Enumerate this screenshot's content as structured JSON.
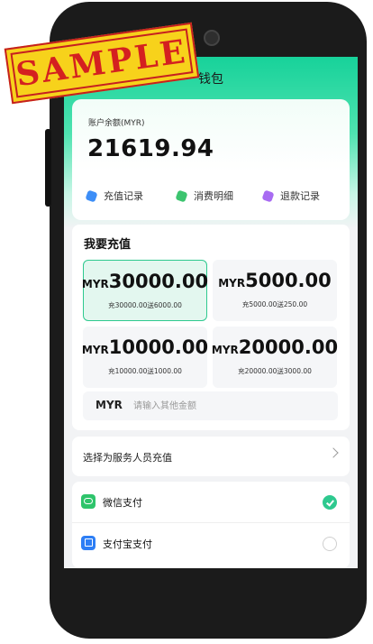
{
  "page": {
    "title": "钱包"
  },
  "balance": {
    "label": "账户余额(MYR)",
    "value": "21619.94"
  },
  "quick_links": [
    {
      "label": "充值记录",
      "icon": "recharge-record-icon",
      "color": "#3d8ef7"
    },
    {
      "label": "消费明细",
      "icon": "consumption-detail-icon",
      "color": "#3cc46f"
    },
    {
      "label": "退款记录",
      "icon": "refund-record-icon",
      "color": "#a86bf2"
    }
  ],
  "recharge": {
    "title": "我要充值",
    "options": [
      {
        "currency": "MYR",
        "amount": "30000.00",
        "bonus": "充30000.00送6000.00",
        "selected": true
      },
      {
        "currency": "MYR",
        "amount": "5000.00",
        "bonus": "充5000.00送250.00",
        "selected": false
      },
      {
        "currency": "MYR",
        "amount": "10000.00",
        "bonus": "充10000.00送1000.00",
        "selected": false
      },
      {
        "currency": "MYR",
        "amount": "20000.00",
        "bonus": "充20000.00送3000.00",
        "selected": false
      }
    ],
    "custom": {
      "currency": "MYR",
      "placeholder": "请输入其他金额",
      "value": ""
    }
  },
  "staff_recharge": {
    "label": "选择为服务人员充值"
  },
  "payment_methods": [
    {
      "label": "微信支付",
      "icon": "wechat-pay-icon",
      "checked": true
    },
    {
      "label": "支付宝支付",
      "icon": "alipay-icon",
      "checked": false
    }
  ],
  "watermark": {
    "text": "SAMPLE"
  },
  "colors": {
    "accent": "#2ec98f",
    "header": "#17d29a"
  }
}
